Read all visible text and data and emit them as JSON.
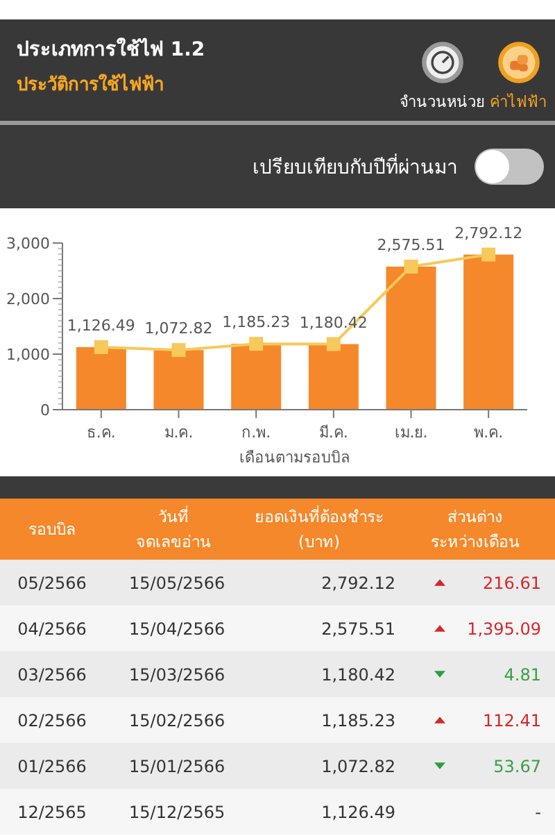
{
  "header": {
    "title": "ประเภทการใช้ไฟ 1.2",
    "subtitle": "ประวัติการใช้ไฟฟ้า",
    "tabs": [
      {
        "label": "จำนวนหน่วย",
        "kind": "gauge",
        "selected": false
      },
      {
        "label": "ค่าไฟฟ้า",
        "kind": "coins",
        "selected": true
      }
    ]
  },
  "compare": {
    "label": "เปรียบเทียบกับปีที่ผ่านมา",
    "on": false
  },
  "chart_data": {
    "type": "bar",
    "xlabel": "เดือนตามรอบบิล",
    "categories": [
      "ธ.ค.",
      "ม.ค.",
      "ก.พ.",
      "มี.ค.",
      "เม.ย.",
      "พ.ค."
    ],
    "series": [
      {
        "type": "bar",
        "color": "#f5882a",
        "values": [
          1126.49,
          1072.82,
          1185.23,
          1180.42,
          2575.51,
          2792.12
        ]
      },
      {
        "type": "line",
        "color": "#f7c85a",
        "marker": "square",
        "values": [
          1126.49,
          1072.82,
          1185.23,
          1180.42,
          2575.51,
          2792.12
        ]
      }
    ],
    "ylim": [
      0,
      3000
    ],
    "yticks": [
      {
        "value": 0,
        "label": "0"
      },
      {
        "value": 1000,
        "label": "1,000"
      },
      {
        "value": 2000,
        "label": "2,000"
      },
      {
        "value": 3000,
        "label": "3,000"
      }
    ],
    "value_labels": [
      "1,126.49",
      "1,072.82",
      "1,185.23",
      "1,180.42",
      "2,575.51",
      "2,792.12"
    ]
  },
  "table": {
    "columns": [
      "รอบบิล",
      "วันที่\nจดเลขอ่าน",
      "ยอดเงินที่ต้องชำระ\n(บาท)",
      "ส่วนต่าง\nระหว่างเดือน"
    ],
    "rows": [
      {
        "cycle": "05/2566",
        "date": "15/05/2566",
        "amount": "2,792.12",
        "kind": "up",
        "diff": "216.61"
      },
      {
        "cycle": "04/2566",
        "date": "15/04/2566",
        "amount": "2,575.51",
        "kind": "up",
        "diff": "1,395.09"
      },
      {
        "cycle": "03/2566",
        "date": "15/03/2566",
        "amount": "1,180.42",
        "kind": "down",
        "diff": "4.81"
      },
      {
        "cycle": "02/2566",
        "date": "15/02/2566",
        "amount": "1,185.23",
        "kind": "up",
        "diff": "112.41"
      },
      {
        "cycle": "01/2566",
        "date": "15/01/2566",
        "amount": "1,072.82",
        "kind": "down",
        "diff": "53.67"
      },
      {
        "cycle": "12/2565",
        "date": "15/12/2565",
        "amount": "1,126.49",
        "kind": "none",
        "diff": "-"
      }
    ]
  }
}
